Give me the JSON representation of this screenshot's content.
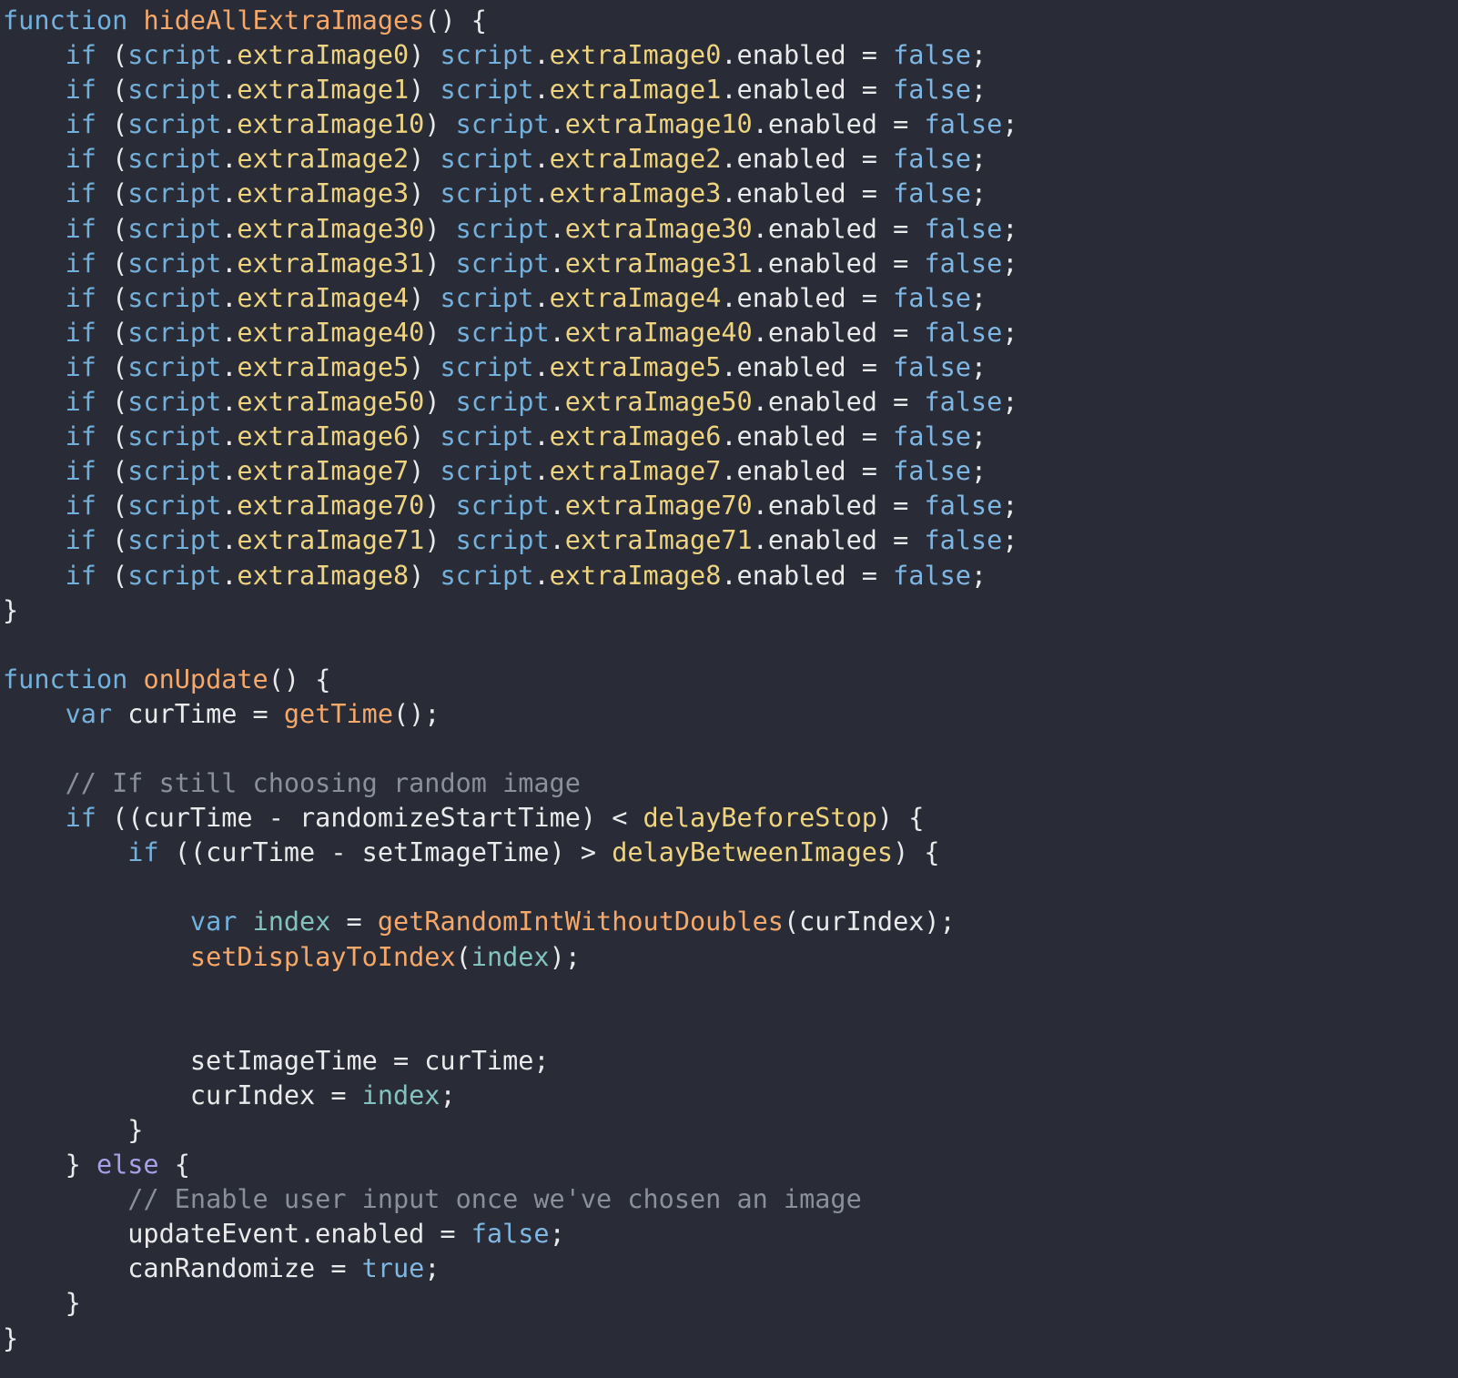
{
  "editor": {
    "theme": {
      "background": "#292c36",
      "keyword": "#74b0dc",
      "keyword_else": "#a8a0e8",
      "function_name": "#f5a86a",
      "property": "#eed480",
      "boolean": "#7fb6e2",
      "local_variable": "#82c3bf",
      "comment": "#8b8f9a",
      "text": "#eaeaec"
    },
    "lines": [
      [
        {
          "t": "kw",
          "v": "function"
        },
        {
          "t": "plain",
          "v": " "
        },
        {
          "t": "fn",
          "v": "hideAllExtraImages"
        },
        {
          "t": "punct",
          "v": "() {"
        }
      ],
      [
        {
          "t": "plain",
          "v": "    "
        },
        {
          "t": "kw",
          "v": "if"
        },
        {
          "t": "punct",
          "v": " ("
        },
        {
          "t": "obj",
          "v": "script"
        },
        {
          "t": "punct",
          "v": "."
        },
        {
          "t": "prop",
          "v": "extraImage0"
        },
        {
          "t": "punct",
          "v": ") "
        },
        {
          "t": "obj",
          "v": "script"
        },
        {
          "t": "punct",
          "v": "."
        },
        {
          "t": "prop",
          "v": "extraImage0"
        },
        {
          "t": "punct",
          "v": ".enabled = "
        },
        {
          "t": "bool",
          "v": "false"
        },
        {
          "t": "punct",
          "v": ";"
        }
      ],
      [
        {
          "t": "plain",
          "v": "    "
        },
        {
          "t": "kw",
          "v": "if"
        },
        {
          "t": "punct",
          "v": " ("
        },
        {
          "t": "obj",
          "v": "script"
        },
        {
          "t": "punct",
          "v": "."
        },
        {
          "t": "prop",
          "v": "extraImage1"
        },
        {
          "t": "punct",
          "v": ") "
        },
        {
          "t": "obj",
          "v": "script"
        },
        {
          "t": "punct",
          "v": "."
        },
        {
          "t": "prop",
          "v": "extraImage1"
        },
        {
          "t": "punct",
          "v": ".enabled = "
        },
        {
          "t": "bool",
          "v": "false"
        },
        {
          "t": "punct",
          "v": ";"
        }
      ],
      [
        {
          "t": "plain",
          "v": "    "
        },
        {
          "t": "kw",
          "v": "if"
        },
        {
          "t": "punct",
          "v": " ("
        },
        {
          "t": "obj",
          "v": "script"
        },
        {
          "t": "punct",
          "v": "."
        },
        {
          "t": "prop",
          "v": "extraImage10"
        },
        {
          "t": "punct",
          "v": ") "
        },
        {
          "t": "obj",
          "v": "script"
        },
        {
          "t": "punct",
          "v": "."
        },
        {
          "t": "prop",
          "v": "extraImage10"
        },
        {
          "t": "punct",
          "v": ".enabled = "
        },
        {
          "t": "bool",
          "v": "false"
        },
        {
          "t": "punct",
          "v": ";"
        }
      ],
      [
        {
          "t": "plain",
          "v": "    "
        },
        {
          "t": "kw",
          "v": "if"
        },
        {
          "t": "punct",
          "v": " ("
        },
        {
          "t": "obj",
          "v": "script"
        },
        {
          "t": "punct",
          "v": "."
        },
        {
          "t": "prop",
          "v": "extraImage2"
        },
        {
          "t": "punct",
          "v": ") "
        },
        {
          "t": "obj",
          "v": "script"
        },
        {
          "t": "punct",
          "v": "."
        },
        {
          "t": "prop",
          "v": "extraImage2"
        },
        {
          "t": "punct",
          "v": ".enabled = "
        },
        {
          "t": "bool",
          "v": "false"
        },
        {
          "t": "punct",
          "v": ";"
        }
      ],
      [
        {
          "t": "plain",
          "v": "    "
        },
        {
          "t": "kw",
          "v": "if"
        },
        {
          "t": "punct",
          "v": " ("
        },
        {
          "t": "obj",
          "v": "script"
        },
        {
          "t": "punct",
          "v": "."
        },
        {
          "t": "prop",
          "v": "extraImage3"
        },
        {
          "t": "punct",
          "v": ") "
        },
        {
          "t": "obj",
          "v": "script"
        },
        {
          "t": "punct",
          "v": "."
        },
        {
          "t": "prop",
          "v": "extraImage3"
        },
        {
          "t": "punct",
          "v": ".enabled = "
        },
        {
          "t": "bool",
          "v": "false"
        },
        {
          "t": "punct",
          "v": ";"
        }
      ],
      [
        {
          "t": "plain",
          "v": "    "
        },
        {
          "t": "kw",
          "v": "if"
        },
        {
          "t": "punct",
          "v": " ("
        },
        {
          "t": "obj",
          "v": "script"
        },
        {
          "t": "punct",
          "v": "."
        },
        {
          "t": "prop",
          "v": "extraImage30"
        },
        {
          "t": "punct",
          "v": ") "
        },
        {
          "t": "obj",
          "v": "script"
        },
        {
          "t": "punct",
          "v": "."
        },
        {
          "t": "prop",
          "v": "extraImage30"
        },
        {
          "t": "punct",
          "v": ".enabled = "
        },
        {
          "t": "bool",
          "v": "false"
        },
        {
          "t": "punct",
          "v": ";"
        }
      ],
      [
        {
          "t": "plain",
          "v": "    "
        },
        {
          "t": "kw",
          "v": "if"
        },
        {
          "t": "punct",
          "v": " ("
        },
        {
          "t": "obj",
          "v": "script"
        },
        {
          "t": "punct",
          "v": "."
        },
        {
          "t": "prop",
          "v": "extraImage31"
        },
        {
          "t": "punct",
          "v": ") "
        },
        {
          "t": "obj",
          "v": "script"
        },
        {
          "t": "punct",
          "v": "."
        },
        {
          "t": "prop",
          "v": "extraImage31"
        },
        {
          "t": "punct",
          "v": ".enabled = "
        },
        {
          "t": "bool",
          "v": "false"
        },
        {
          "t": "punct",
          "v": ";"
        }
      ],
      [
        {
          "t": "plain",
          "v": "    "
        },
        {
          "t": "kw",
          "v": "if"
        },
        {
          "t": "punct",
          "v": " ("
        },
        {
          "t": "obj",
          "v": "script"
        },
        {
          "t": "punct",
          "v": "."
        },
        {
          "t": "prop",
          "v": "extraImage4"
        },
        {
          "t": "punct",
          "v": ") "
        },
        {
          "t": "obj",
          "v": "script"
        },
        {
          "t": "punct",
          "v": "."
        },
        {
          "t": "prop",
          "v": "extraImage4"
        },
        {
          "t": "punct",
          "v": ".enabled = "
        },
        {
          "t": "bool",
          "v": "false"
        },
        {
          "t": "punct",
          "v": ";"
        }
      ],
      [
        {
          "t": "plain",
          "v": "    "
        },
        {
          "t": "kw",
          "v": "if"
        },
        {
          "t": "punct",
          "v": " ("
        },
        {
          "t": "obj",
          "v": "script"
        },
        {
          "t": "punct",
          "v": "."
        },
        {
          "t": "prop",
          "v": "extraImage40"
        },
        {
          "t": "punct",
          "v": ") "
        },
        {
          "t": "obj",
          "v": "script"
        },
        {
          "t": "punct",
          "v": "."
        },
        {
          "t": "prop",
          "v": "extraImage40"
        },
        {
          "t": "punct",
          "v": ".enabled = "
        },
        {
          "t": "bool",
          "v": "false"
        },
        {
          "t": "punct",
          "v": ";"
        }
      ],
      [
        {
          "t": "plain",
          "v": "    "
        },
        {
          "t": "kw",
          "v": "if"
        },
        {
          "t": "punct",
          "v": " ("
        },
        {
          "t": "obj",
          "v": "script"
        },
        {
          "t": "punct",
          "v": "."
        },
        {
          "t": "prop",
          "v": "extraImage5"
        },
        {
          "t": "punct",
          "v": ") "
        },
        {
          "t": "obj",
          "v": "script"
        },
        {
          "t": "punct",
          "v": "."
        },
        {
          "t": "prop",
          "v": "extraImage5"
        },
        {
          "t": "punct",
          "v": ".enabled = "
        },
        {
          "t": "bool",
          "v": "false"
        },
        {
          "t": "punct",
          "v": ";"
        }
      ],
      [
        {
          "t": "plain",
          "v": "    "
        },
        {
          "t": "kw",
          "v": "if"
        },
        {
          "t": "punct",
          "v": " ("
        },
        {
          "t": "obj",
          "v": "script"
        },
        {
          "t": "punct",
          "v": "."
        },
        {
          "t": "prop",
          "v": "extraImage50"
        },
        {
          "t": "punct",
          "v": ") "
        },
        {
          "t": "obj",
          "v": "script"
        },
        {
          "t": "punct",
          "v": "."
        },
        {
          "t": "prop",
          "v": "extraImage50"
        },
        {
          "t": "punct",
          "v": ".enabled = "
        },
        {
          "t": "bool",
          "v": "false"
        },
        {
          "t": "punct",
          "v": ";"
        }
      ],
      [
        {
          "t": "plain",
          "v": "    "
        },
        {
          "t": "kw",
          "v": "if"
        },
        {
          "t": "punct",
          "v": " ("
        },
        {
          "t": "obj",
          "v": "script"
        },
        {
          "t": "punct",
          "v": "."
        },
        {
          "t": "prop",
          "v": "extraImage6"
        },
        {
          "t": "punct",
          "v": ") "
        },
        {
          "t": "obj",
          "v": "script"
        },
        {
          "t": "punct",
          "v": "."
        },
        {
          "t": "prop",
          "v": "extraImage6"
        },
        {
          "t": "punct",
          "v": ".enabled = "
        },
        {
          "t": "bool",
          "v": "false"
        },
        {
          "t": "punct",
          "v": ";"
        }
      ],
      [
        {
          "t": "plain",
          "v": "    "
        },
        {
          "t": "kw",
          "v": "if"
        },
        {
          "t": "punct",
          "v": " ("
        },
        {
          "t": "obj",
          "v": "script"
        },
        {
          "t": "punct",
          "v": "."
        },
        {
          "t": "prop",
          "v": "extraImage7"
        },
        {
          "t": "punct",
          "v": ") "
        },
        {
          "t": "obj",
          "v": "script"
        },
        {
          "t": "punct",
          "v": "."
        },
        {
          "t": "prop",
          "v": "extraImage7"
        },
        {
          "t": "punct",
          "v": ".enabled = "
        },
        {
          "t": "bool",
          "v": "false"
        },
        {
          "t": "punct",
          "v": ";"
        }
      ],
      [
        {
          "t": "plain",
          "v": "    "
        },
        {
          "t": "kw",
          "v": "if"
        },
        {
          "t": "punct",
          "v": " ("
        },
        {
          "t": "obj",
          "v": "script"
        },
        {
          "t": "punct",
          "v": "."
        },
        {
          "t": "prop",
          "v": "extraImage70"
        },
        {
          "t": "punct",
          "v": ") "
        },
        {
          "t": "obj",
          "v": "script"
        },
        {
          "t": "punct",
          "v": "."
        },
        {
          "t": "prop",
          "v": "extraImage70"
        },
        {
          "t": "punct",
          "v": ".enabled = "
        },
        {
          "t": "bool",
          "v": "false"
        },
        {
          "t": "punct",
          "v": ";"
        }
      ],
      [
        {
          "t": "plain",
          "v": "    "
        },
        {
          "t": "kw",
          "v": "if"
        },
        {
          "t": "punct",
          "v": " ("
        },
        {
          "t": "obj",
          "v": "script"
        },
        {
          "t": "punct",
          "v": "."
        },
        {
          "t": "prop",
          "v": "extraImage71"
        },
        {
          "t": "punct",
          "v": ") "
        },
        {
          "t": "obj",
          "v": "script"
        },
        {
          "t": "punct",
          "v": "."
        },
        {
          "t": "prop",
          "v": "extraImage71"
        },
        {
          "t": "punct",
          "v": ".enabled = "
        },
        {
          "t": "bool",
          "v": "false"
        },
        {
          "t": "punct",
          "v": ";"
        }
      ],
      [
        {
          "t": "plain",
          "v": "    "
        },
        {
          "t": "kw",
          "v": "if"
        },
        {
          "t": "punct",
          "v": " ("
        },
        {
          "t": "obj",
          "v": "script"
        },
        {
          "t": "punct",
          "v": "."
        },
        {
          "t": "prop",
          "v": "extraImage8"
        },
        {
          "t": "punct",
          "v": ") "
        },
        {
          "t": "obj",
          "v": "script"
        },
        {
          "t": "punct",
          "v": "."
        },
        {
          "t": "prop",
          "v": "extraImage8"
        },
        {
          "t": "punct",
          "v": ".enabled = "
        },
        {
          "t": "bool",
          "v": "false"
        },
        {
          "t": "punct",
          "v": ";"
        }
      ],
      [
        {
          "t": "punct",
          "v": "}"
        }
      ],
      [],
      [
        {
          "t": "kw",
          "v": "function"
        },
        {
          "t": "plain",
          "v": " "
        },
        {
          "t": "fn",
          "v": "onUpdate"
        },
        {
          "t": "punct",
          "v": "() {"
        }
      ],
      [
        {
          "t": "plain",
          "v": "    "
        },
        {
          "t": "kw",
          "v": "var"
        },
        {
          "t": "plain",
          "v": " curTime = "
        },
        {
          "t": "fn",
          "v": "getTime"
        },
        {
          "t": "punct",
          "v": "();"
        }
      ],
      [],
      [
        {
          "t": "plain",
          "v": "    "
        },
        {
          "t": "comment",
          "v": "// If still choosing random image"
        }
      ],
      [
        {
          "t": "plain",
          "v": "    "
        },
        {
          "t": "kw",
          "v": "if"
        },
        {
          "t": "plain",
          "v": " ((curTime - randomizeStartTime) < "
        },
        {
          "t": "prop",
          "v": "delayBeforeStop"
        },
        {
          "t": "punct",
          "v": ") {"
        }
      ],
      [
        {
          "t": "plain",
          "v": "        "
        },
        {
          "t": "kw",
          "v": "if"
        },
        {
          "t": "plain",
          "v": " ((curTime - setImageTime) > "
        },
        {
          "t": "prop",
          "v": "delayBetweenImages"
        },
        {
          "t": "punct",
          "v": ") {"
        }
      ],
      [],
      [
        {
          "t": "plain",
          "v": "            "
        },
        {
          "t": "kw",
          "v": "var"
        },
        {
          "t": "plain",
          "v": " "
        },
        {
          "t": "var",
          "v": "index"
        },
        {
          "t": "plain",
          "v": " = "
        },
        {
          "t": "fn",
          "v": "getRandomIntWithoutDoubles"
        },
        {
          "t": "plain",
          "v": "(curIndex);"
        }
      ],
      [
        {
          "t": "plain",
          "v": "            "
        },
        {
          "t": "fn",
          "v": "setDisplayToIndex"
        },
        {
          "t": "punct",
          "v": "("
        },
        {
          "t": "var",
          "v": "index"
        },
        {
          "t": "punct",
          "v": ");"
        }
      ],
      [],
      [],
      [
        {
          "t": "plain",
          "v": "            setImageTime = curTime;"
        }
      ],
      [
        {
          "t": "plain",
          "v": "            curIndex = "
        },
        {
          "t": "var",
          "v": "index"
        },
        {
          "t": "punct",
          "v": ";"
        }
      ],
      [
        {
          "t": "plain",
          "v": "        }"
        }
      ],
      [
        {
          "t": "plain",
          "v": "    } "
        },
        {
          "t": "kw2",
          "v": "else"
        },
        {
          "t": "plain",
          "v": " {"
        }
      ],
      [
        {
          "t": "plain",
          "v": "        "
        },
        {
          "t": "comment",
          "v": "// Enable user input once we've chosen an image"
        }
      ],
      [
        {
          "t": "plain",
          "v": "        updateEvent.enabled = "
        },
        {
          "t": "bool",
          "v": "false"
        },
        {
          "t": "punct",
          "v": ";"
        }
      ],
      [
        {
          "t": "plain",
          "v": "        canRandomize = "
        },
        {
          "t": "bool",
          "v": "true"
        },
        {
          "t": "punct",
          "v": ";"
        }
      ],
      [
        {
          "t": "plain",
          "v": "    }"
        }
      ],
      [
        {
          "t": "punct",
          "v": "}"
        }
      ]
    ]
  }
}
